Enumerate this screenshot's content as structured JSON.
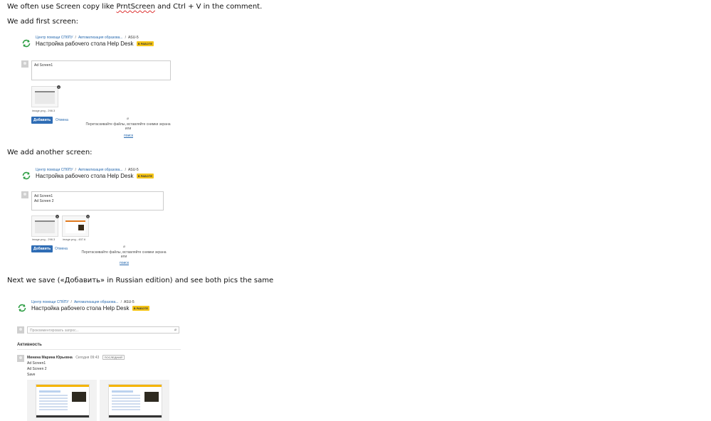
{
  "doc": {
    "line1_a": "We often use Screen copy like",
    "line1_spell": "PrntScreen",
    "line1_b": "and Ctrl + V in the comment.",
    "line2": "We add first screen:",
    "line3": "We add another screen:",
    "line4": "Next we save («Добавить» in Russian edition) and see both pics the same"
  },
  "issue": {
    "crumb_1": "Центр помощи СПбПУ",
    "crumb_2": "Автоматизация образова...",
    "crumb_sep": "/",
    "key": "ASU-5",
    "title": "Настройка рабочего стола Help Desk",
    "status": "В РАБОТЕ"
  },
  "editor": {
    "first_text_1": "Ad Screen1",
    "second_text_1": "Ad Screen1",
    "second_text_2": "Ad Screen 2",
    "thumb1_caption": "image.png - 298.3",
    "thumb2_caption": "image.png - 457.6",
    "close": "×",
    "add_button": "Добавить",
    "cancel_link": "Отмена",
    "drop_hint": "Перетаскивайте файлы, вставляйте снимки экрана или",
    "drop_link": "поиск",
    "clip_icon": "paperclip-icon"
  },
  "saved": {
    "search_placeholder": "Прокомментировать запрос...",
    "activity_heading": "Активность",
    "author": "Минина Марина Юрьевна",
    "time": "Сегодня 09:43",
    "last_badge": "ПОСЛЕДНИЙ",
    "line_1": "Ad Screen1",
    "line_2": "Ad Screen 2",
    "line_3": "Save"
  },
  "colors": {
    "accent": "#2f6db5",
    "status": "#f5c518",
    "refresh": "#2e9e44"
  }
}
